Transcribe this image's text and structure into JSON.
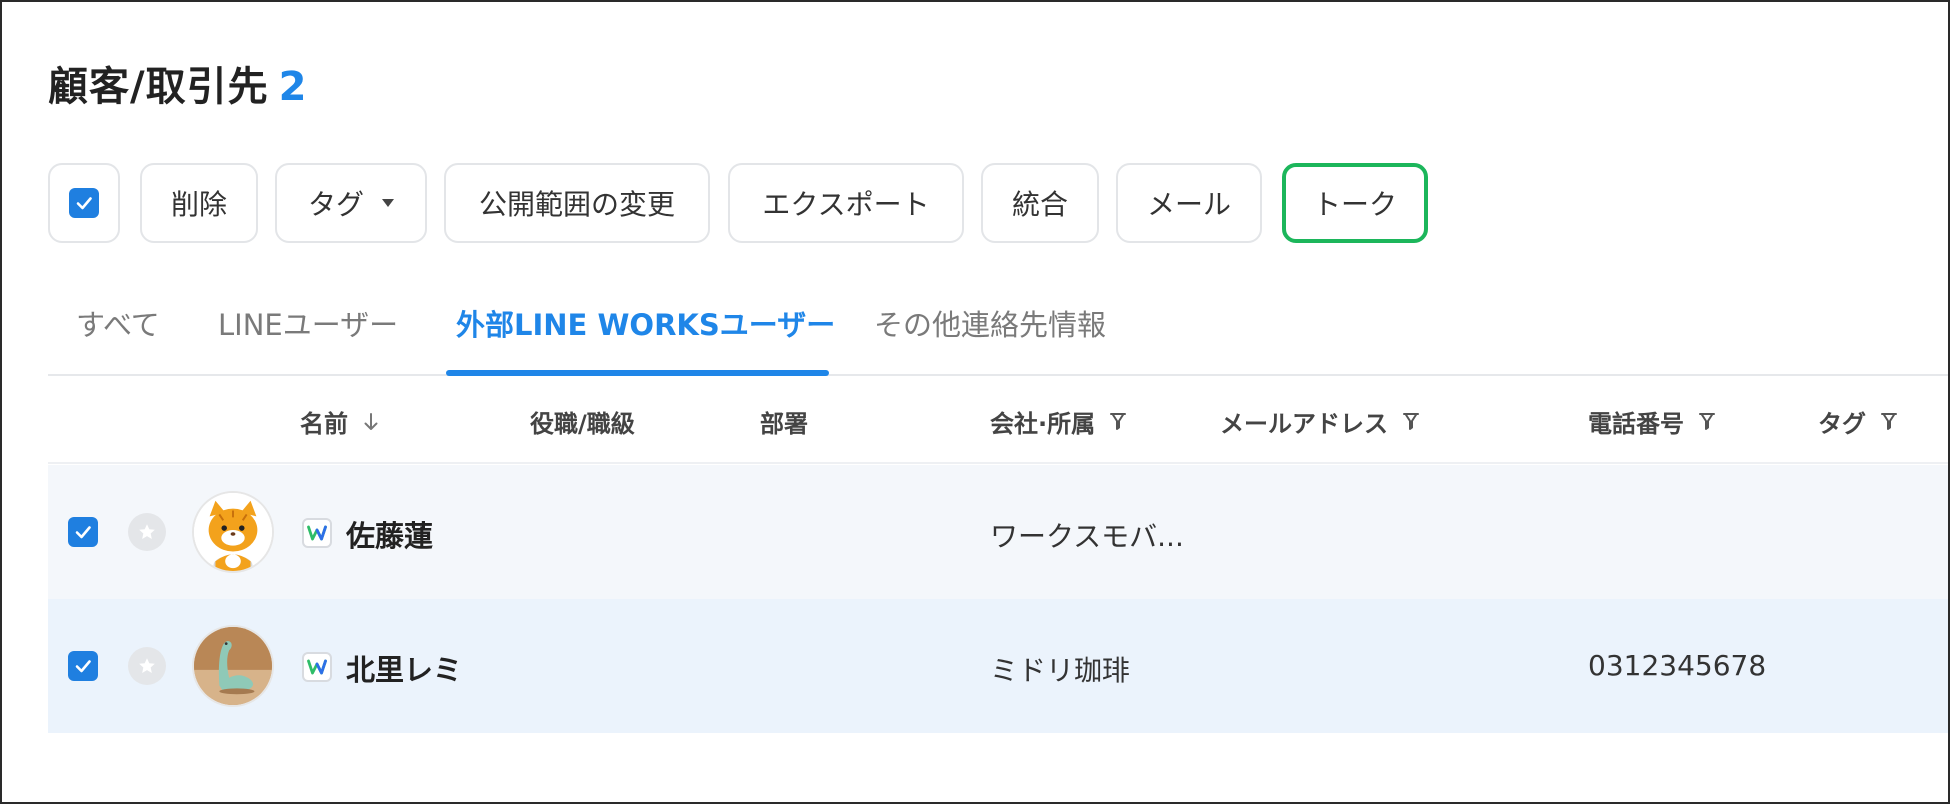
{
  "page": {
    "title": "顧客/取引先",
    "count": "2"
  },
  "toolbar": {
    "delete_label": "削除",
    "tag_label": "タグ",
    "visibility_label": "公開範囲の変更",
    "export_label": "エクスポート",
    "merge_label": "統合",
    "mail_label": "メール",
    "talk_label": "トーク"
  },
  "tabs": [
    {
      "label": "すべて"
    },
    {
      "label": "LINEユーザー"
    },
    {
      "label": "外部LINE WORKSユーザー"
    },
    {
      "label": "その他連絡先情報"
    }
  ],
  "columns": {
    "name": "名前",
    "position": "役職/職級",
    "department": "部署",
    "company": "会社·所属",
    "email": "メールアドレス",
    "phone": "電話番号",
    "tag": "タグ"
  },
  "rows": [
    {
      "name": "佐藤蓮",
      "company": "ワークスモバ...",
      "phone": ""
    },
    {
      "name": "北里レミ",
      "company": "ミドリ珈琲",
      "phone": "0312345678"
    }
  ],
  "colors": {
    "accent": "#1f86e8",
    "talk_border": "#1cb65b",
    "checkbox": "#1f7fe0"
  },
  "icons": {
    "checkbox": "checkmark-icon",
    "tag_dropdown": "caret-down-icon",
    "sort": "arrow-down-icon",
    "filter": "filter-icon",
    "favorite": "star-icon",
    "line_works_badge": "line-works-icon"
  }
}
